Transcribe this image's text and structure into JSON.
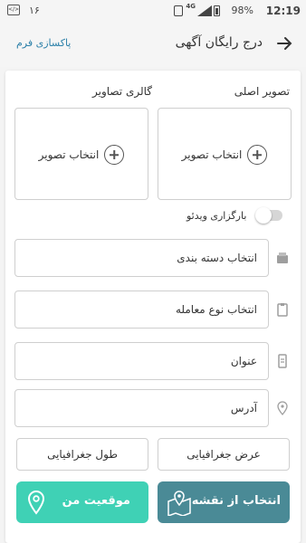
{
  "status_bar": {
    "time": "12:19",
    "battery": "98%",
    "network": "4G",
    "notification_count": "١۶",
    "code_icon_text": "</>"
  },
  "app_bar": {
    "title": "درج رایگان آگهی",
    "reset_label": "پاکسازی فرم"
  },
  "images": {
    "main_label": "تصویر اصلی",
    "gallery_label": "گالری تصاویر",
    "main_select": "انتخاب تصویر",
    "gallery_select": "انتخاب تصویر"
  },
  "video_toggle": {
    "label": "بارگزاری ویدئو",
    "enabled": false
  },
  "fields": {
    "category": "انتخاب دسته بندی",
    "deal_type": "انتخاب نوع معامله",
    "title": "عنوان",
    "address": "آدرس"
  },
  "coords": {
    "latitude": "عرض جغرافیایی",
    "longitude": "طول جغرافیایی"
  },
  "location_buttons": {
    "pick_from_map": "انتخاب از نقشه",
    "my_location": "موقعیت من"
  },
  "colors": {
    "map_button": "#4a8a96",
    "my_location_button": "#3fd1b5",
    "link": "#2a7fa8"
  }
}
